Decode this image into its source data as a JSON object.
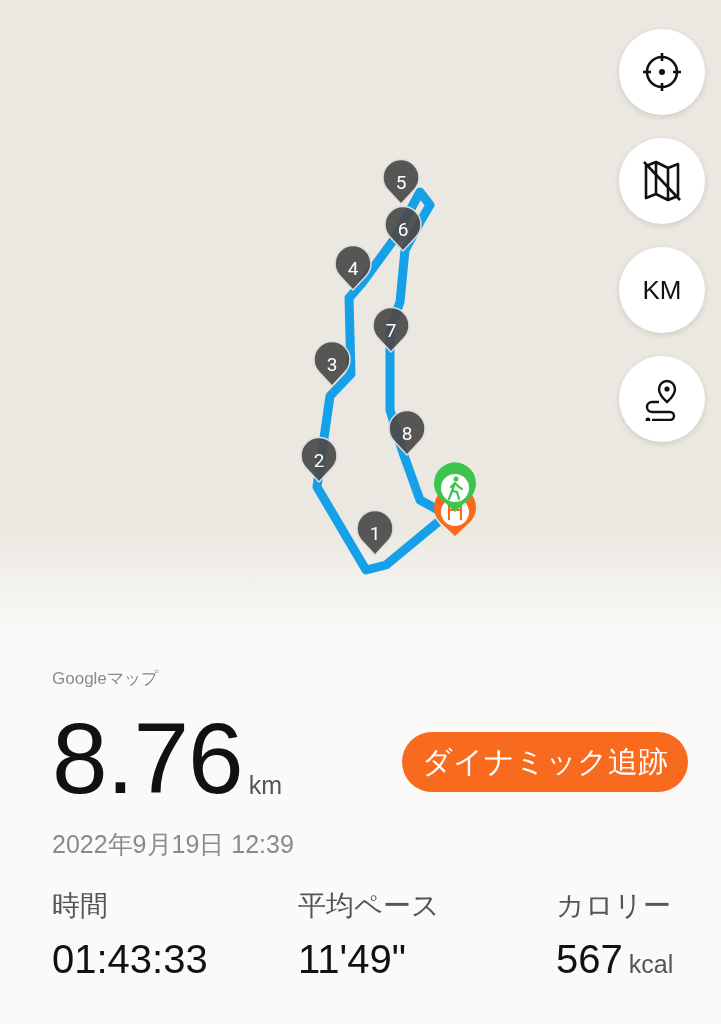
{
  "map": {
    "markers": [
      {
        "label": "1"
      },
      {
        "label": "2"
      },
      {
        "label": "3"
      },
      {
        "label": "4"
      },
      {
        "label": "5"
      },
      {
        "label": "6"
      },
      {
        "label": "7"
      },
      {
        "label": "8"
      }
    ],
    "controls": [
      {
        "kind": "locate"
      },
      {
        "kind": "map-toggle"
      },
      {
        "kind": "unit",
        "label": "KM"
      },
      {
        "kind": "route"
      }
    ]
  },
  "summary": {
    "source": "Googleマップ",
    "distance": "8.76",
    "distance_unit": "km",
    "action_button": "ダイナミック追跡",
    "date": "2022年9月19日 12:39",
    "stats": [
      {
        "label": "時間",
        "value": "01:43:33"
      },
      {
        "label": "平均ペース",
        "value": "11'49\""
      },
      {
        "label": "カロリー",
        "value": "567",
        "unit": "kcal"
      }
    ]
  }
}
